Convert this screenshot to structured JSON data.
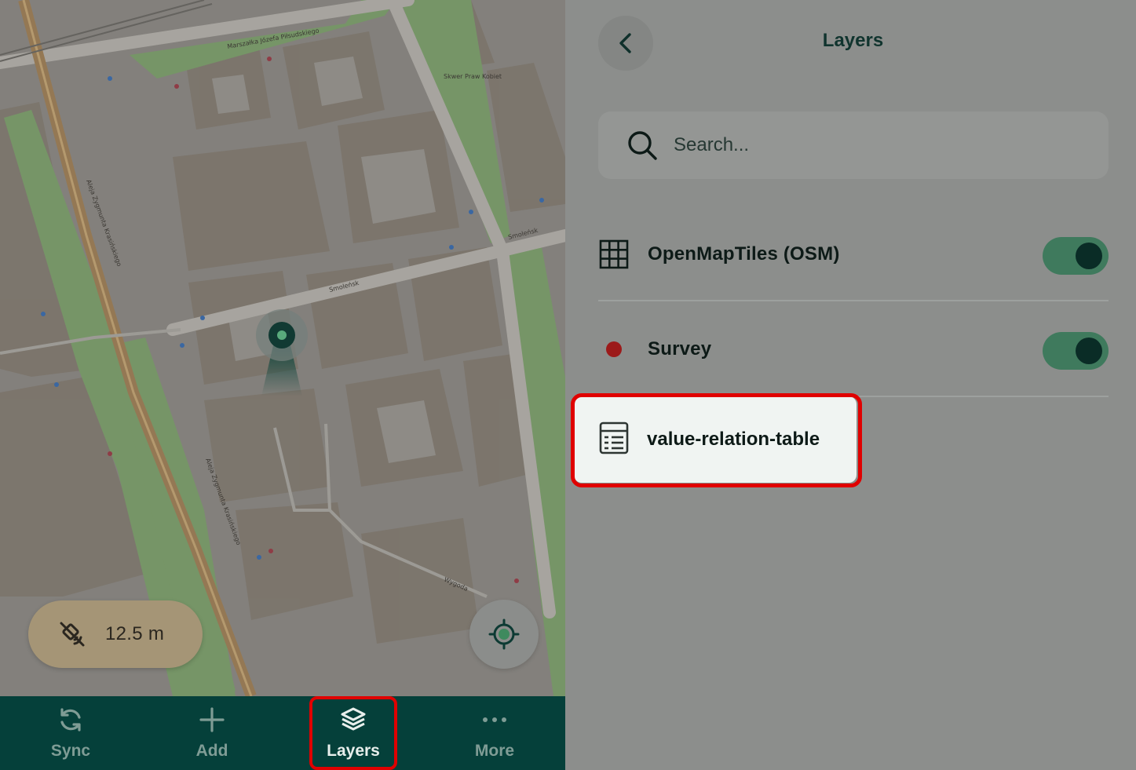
{
  "map": {
    "accuracy_text": "12.5 m",
    "street_labels": [
      "Smoleńsk",
      "Smoleńsk",
      "Wygoda",
      "Aleja Zygmunta Krasińskiego",
      "Aleja Zygmunta Krasińskiego",
      "Marszałka Józefa Piłsudskiego",
      "Skwer Praw Kobiet"
    ]
  },
  "bottom_nav": {
    "items": [
      {
        "label": "Sync",
        "icon": "sync-icon"
      },
      {
        "label": "Add",
        "icon": "plus-icon"
      },
      {
        "label": "Layers",
        "icon": "layers-icon",
        "active": true
      },
      {
        "label": "More",
        "icon": "more-dots-icon"
      }
    ]
  },
  "layers_panel": {
    "title": "Layers",
    "search_placeholder": "Search...",
    "layers": [
      {
        "name": "OpenMapTiles (OSM)",
        "icon": "raster-grid-icon",
        "visible": true
      },
      {
        "name": "Survey",
        "icon": "point-layer-icon",
        "visible": true
      },
      {
        "name": "value-relation-table",
        "icon": "table-icon"
      }
    ]
  },
  "colors": {
    "nav_background": "#05403a",
    "toggle_on": "#3f7a5d",
    "highlight": "#e00000",
    "accuracy_pill": "#a59576"
  }
}
